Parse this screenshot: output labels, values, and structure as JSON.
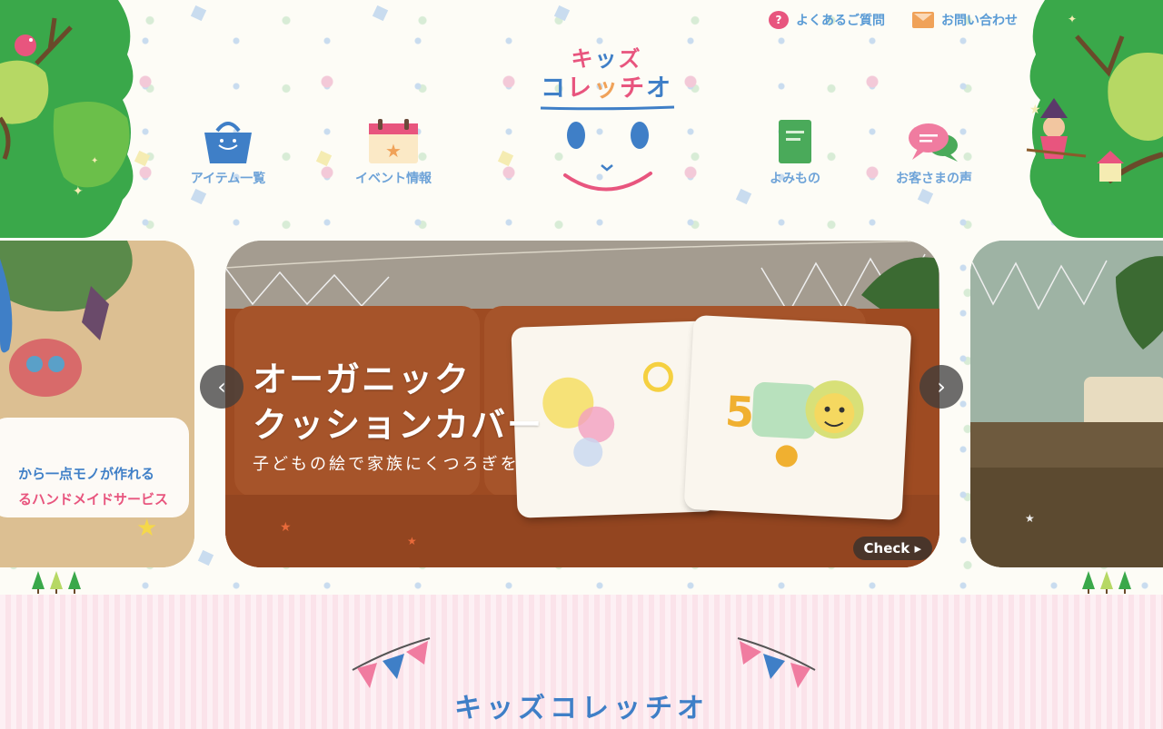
{
  "header": {
    "faq_label": "よくあるご質問",
    "contact_label": "お問い合わせ",
    "logo_line1": [
      "キ",
      "ッ",
      "ズ"
    ],
    "logo_line2": [
      "コ",
      "レ",
      "ッ",
      "チ",
      "オ"
    ]
  },
  "nav": {
    "items": [
      {
        "label": "アイテム一覧",
        "icon": "basket-icon"
      },
      {
        "label": "イベント情報",
        "icon": "calendar-icon"
      },
      {
        "label": "よみもの",
        "icon": "book-icon"
      },
      {
        "label": "お客さまの声",
        "icon": "speech-bubble-icon"
      }
    ]
  },
  "carousel": {
    "main": {
      "title_line1": "オーガニック",
      "title_line2": "クッションカバー",
      "subtitle": "子どもの絵で家族にくつろぎを",
      "check_label": "Check ▸"
    },
    "left": {
      "line1": "から一点モノが作れる",
      "line2": "るハンドメイドサービス"
    },
    "prev_label": "‹",
    "next_label": "›"
  },
  "section": {
    "title": "キッズコレッチオ"
  },
  "colors": {
    "pink": "#e8557e",
    "blue": "#3f7fc7",
    "light_blue": "#6ea3d8",
    "green": "#6bbf6b",
    "orange": "#f0a259"
  }
}
